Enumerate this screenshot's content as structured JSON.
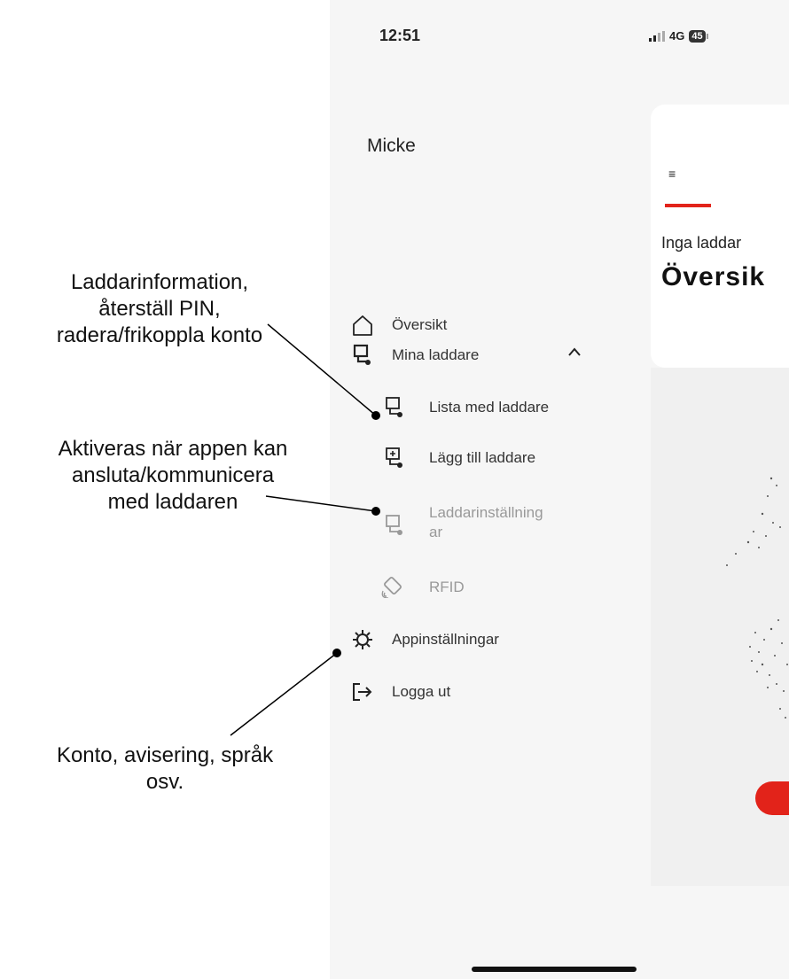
{
  "status_bar": {
    "time": "12:51",
    "network": "4G",
    "battery": "45"
  },
  "drawer": {
    "user_name": "Micke",
    "items": [
      {
        "label": "Översikt",
        "icon": "house-icon"
      },
      {
        "label": "Mina laddare",
        "icon": "charger-icon",
        "expanded": true
      },
      {
        "label": "Lista med laddare",
        "icon": "charger-icon"
      },
      {
        "label": "Lägg till laddare",
        "icon": "charger-add-icon"
      },
      {
        "label_line1": "Laddarinställning",
        "label_line2": "ar",
        "icon": "charger-settings-icon",
        "disabled": true
      },
      {
        "label": "RFID",
        "icon": "rfid-icon",
        "disabled": true
      },
      {
        "label": "Appinställningar",
        "icon": "gear-icon"
      },
      {
        "label": "Logga ut",
        "icon": "logout-icon"
      }
    ]
  },
  "background_card": {
    "menu_symbol": "≡",
    "subtitle": "Inga laddar",
    "title": "Översik"
  },
  "annotations": {
    "charger_info": [
      "Laddarinformation,",
      "återställ PIN,",
      "radera/frikoppla konto"
    ],
    "activated": [
      "Aktiveras när appen kan",
      "ansluta/kommunicera",
      "med laddaren"
    ],
    "account": [
      "Konto, avisering, språk",
      "osv."
    ]
  },
  "colors": {
    "accent": "#e2231a",
    "drawer_bg": "#f6f6f6",
    "text": "#222222",
    "disabled": "#999999"
  }
}
